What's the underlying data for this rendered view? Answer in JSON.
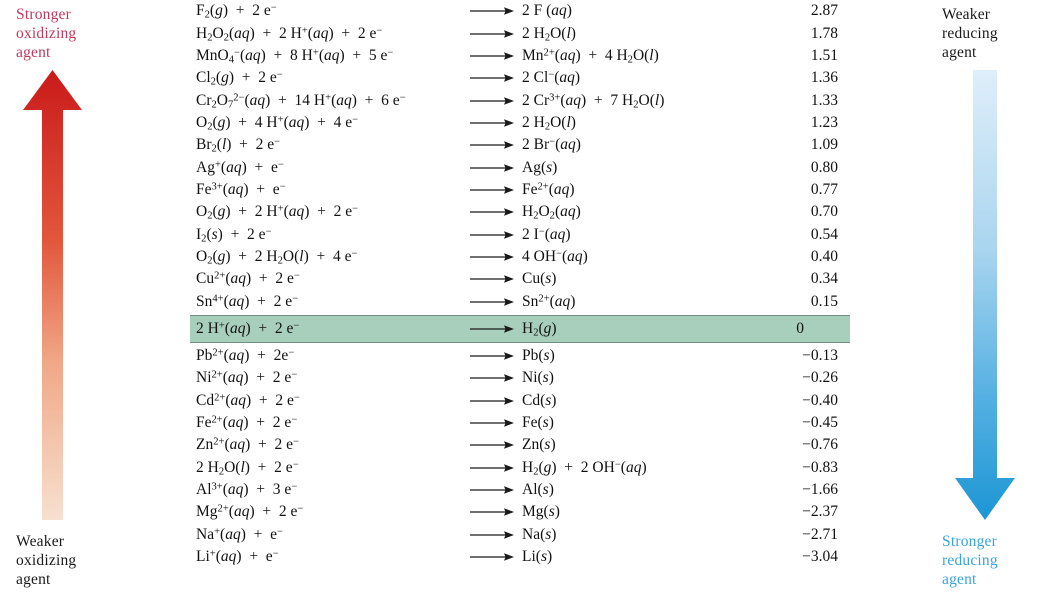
{
  "left_axis": {
    "top_label": "Stronger\noxidizing\nagent",
    "top_label_line1": "Stronger",
    "top_label_line2": "oxidizing",
    "top_label_line3": "agent",
    "bottom_label_line1": "Weaker",
    "bottom_label_line2": "oxidizing",
    "bottom_label_line3": "agent",
    "direction": "up",
    "color_top": "#c0395c",
    "color_bottom": "#1a1a1a",
    "gradient_from": "#cc1f1f",
    "gradient_to": "#f6dccb"
  },
  "right_axis": {
    "top_label_line1": "Weaker",
    "top_label_line2": "reducing",
    "top_label_line3": "agent",
    "bottom_label_line1": "Stronger",
    "bottom_label_line2": "reducing",
    "bottom_label_line3": "agent",
    "direction": "down",
    "color_top": "#1a1a1a",
    "color_bottom": "#3ba3dd",
    "gradient_from": "#dcecf8",
    "gradient_to": "#1f9ad6"
  },
  "table": {
    "highlight_color": "#a7cfbc",
    "arrow_glyph": "long-right-arrow",
    "rows": [
      {
        "reactant_html": "F<sub>2</sub>(<i>g</i>)&nbsp; + &nbsp;2 e<sup>−</sup>",
        "product_html": "2 F (<i>aq</i>)",
        "volt": "2.87",
        "highlight": false
      },
      {
        "reactant_html": "H<sub>2</sub>O<sub>2</sub>(<i>aq</i>)&nbsp; + &nbsp;2 H<sup>+</sup>(<i>aq</i>)&nbsp; + &nbsp;2 e<sup>−</sup>",
        "product_html": "2 H<sub>2</sub>O(<i>l</i>)",
        "volt": "1.78",
        "highlight": false
      },
      {
        "reactant_html": "MnO<sub>4</sub><sup>−</sup>(<i>aq</i>)&nbsp; + &nbsp;8 H<sup>+</sup>(<i>aq</i>)&nbsp; + &nbsp;5 e<sup>−</sup>",
        "product_html": "Mn<sup>2+</sup>(<i>aq</i>)&nbsp; + &nbsp;4 H<sub>2</sub>O(<i>l</i>)",
        "volt": "1.51",
        "highlight": false
      },
      {
        "reactant_html": "Cl<sub>2</sub>(<i>g</i>)&nbsp; + &nbsp;2 e<sup>−</sup>",
        "product_html": "2 Cl<sup>−</sup>(<i>aq</i>)",
        "volt": "1.36",
        "highlight": false
      },
      {
        "reactant_html": "Cr<sub>2</sub>O<sub>7</sub><sup>2−</sup>(<i>aq</i>)&nbsp; + &nbsp;14 H<sup>+</sup>(<i>aq</i>)&nbsp; + &nbsp;6 e<sup>−</sup>",
        "product_html": "2 Cr<sup>3+</sup>(<i>aq</i>)&nbsp; + &nbsp;7 H<sub>2</sub>O(<i>l</i>)",
        "volt": "1.33",
        "highlight": false
      },
      {
        "reactant_html": "O<sub>2</sub>(<i>g</i>)&nbsp; + &nbsp;4 H<sup>+</sup>(<i>aq</i>)&nbsp; + &nbsp;4 e<sup>−</sup>",
        "product_html": "2 H<sub>2</sub>O(<i>l</i>)",
        "volt": "1.23",
        "highlight": false
      },
      {
        "reactant_html": "Br<sub>2</sub>(<i>l</i>)&nbsp; + &nbsp;2 e<sup>−</sup>",
        "product_html": "2 Br<sup>−</sup>(<i>aq</i>)",
        "volt": "1.09",
        "highlight": false
      },
      {
        "reactant_html": "Ag<sup>+</sup>(<i>aq</i>)&nbsp; + &nbsp;e<sup>−</sup>",
        "product_html": "Ag(<i>s</i>)",
        "volt": "0.80",
        "highlight": false
      },
      {
        "reactant_html": "Fe<sup>3+</sup>(<i>aq</i>)&nbsp; + &nbsp;e<sup>−</sup>",
        "product_html": "Fe<sup>2+</sup>(<i>aq</i>)",
        "volt": "0.77",
        "highlight": false
      },
      {
        "reactant_html": "O<sub>2</sub>(<i>g</i>)&nbsp; + &nbsp;2 H<sup>+</sup>(<i>aq</i>)&nbsp; + &nbsp;2 e<sup>−</sup>",
        "product_html": "H<sub>2</sub>O<sub>2</sub>(<i>aq</i>)",
        "volt": "0.70",
        "highlight": false
      },
      {
        "reactant_html": "I<sub>2</sub>(<i>s</i>)&nbsp; + &nbsp;2 e<sup>−</sup>",
        "product_html": "2 I<sup>−</sup>(<i>aq</i>)",
        "volt": "0.54",
        "highlight": false
      },
      {
        "reactant_html": "O<sub>2</sub>(<i>g</i>)&nbsp; + &nbsp;2 H<sub>2</sub>O(<i>l</i>)&nbsp; + &nbsp;4 e<sup>−</sup>",
        "product_html": "4 OH<sup>−</sup>(<i>aq</i>)",
        "volt": "0.40",
        "highlight": false
      },
      {
        "reactant_html": "Cu<sup>2+</sup>(<i>aq</i>)&nbsp; + &nbsp;2 e<sup>−</sup>",
        "product_html": "Cu(<i>s</i>)",
        "volt": "0.34",
        "highlight": false
      },
      {
        "reactant_html": "Sn<sup>4+</sup>(<i>aq</i>)&nbsp; + &nbsp;2 e<sup>−</sup>",
        "product_html": "Sn<sup>2+</sup>(<i>aq</i>)",
        "volt": "0.15",
        "highlight": false
      },
      {
        "reactant_html": "2 H<sup>+</sup>(<i>aq</i>)&nbsp; + &nbsp;2 e<sup>−</sup>",
        "product_html": "H<sub>2</sub>(<i>g</i>)",
        "volt": "0",
        "highlight": true
      },
      {
        "reactant_html": "Pb<sup>2+</sup>(<i>aq</i>)&nbsp; + &nbsp;2e<sup>−</sup>",
        "product_html": "Pb(<i>s</i>)",
        "volt": "−0.13",
        "highlight": false
      },
      {
        "reactant_html": "Ni<sup>2+</sup>(<i>aq</i>)&nbsp; + &nbsp;2 e<sup>−</sup>",
        "product_html": "Ni(<i>s</i>)",
        "volt": "−0.26",
        "highlight": false
      },
      {
        "reactant_html": "Cd<sup>2+</sup>(<i>aq</i>)&nbsp; + &nbsp;2 e<sup>−</sup>",
        "product_html": "Cd(<i>s</i>)",
        "volt": "−0.40",
        "highlight": false
      },
      {
        "reactant_html": "Fe<sup>2+</sup>(<i>aq</i>)&nbsp; + &nbsp;2 e<sup>−</sup>",
        "product_html": "Fe(<i>s</i>)",
        "volt": "−0.45",
        "highlight": false
      },
      {
        "reactant_html": "Zn<sup>2+</sup>(<i>aq</i>)&nbsp; + &nbsp;2 e<sup>−</sup>",
        "product_html": "Zn(<i>s</i>)",
        "volt": "−0.76",
        "highlight": false
      },
      {
        "reactant_html": "2 H<sub>2</sub>O(<i>l</i>)&nbsp; + &nbsp;2 e<sup>−</sup>",
        "product_html": "H<sub>2</sub>(<i>g</i>)&nbsp; + &nbsp;2 OH<sup>−</sup>(<i>aq</i>)",
        "volt": "−0.83",
        "highlight": false
      },
      {
        "reactant_html": "Al<sup>3+</sup>(<i>aq</i>)&nbsp; + &nbsp;3 e<sup>−</sup>",
        "product_html": "Al(<i>s</i>)",
        "volt": "−1.66",
        "highlight": false
      },
      {
        "reactant_html": "Mg<sup>2+</sup>(<i>aq</i>)&nbsp; + &nbsp;2 e<sup>−</sup>",
        "product_html": "Mg(<i>s</i>)",
        "volt": "−2.37",
        "highlight": false
      },
      {
        "reactant_html": "Na<sup>+</sup>(<i>aq</i>)&nbsp; + &nbsp;e<sup>−</sup>",
        "product_html": "Na(<i>s</i>)",
        "volt": "−2.71",
        "highlight": false
      },
      {
        "reactant_html": "Li<sup>+</sup>(<i>aq</i>)&nbsp; + &nbsp;e<sup>−</sup>",
        "product_html": "Li(<i>s</i>)",
        "volt": "−3.04",
        "highlight": false
      }
    ]
  }
}
